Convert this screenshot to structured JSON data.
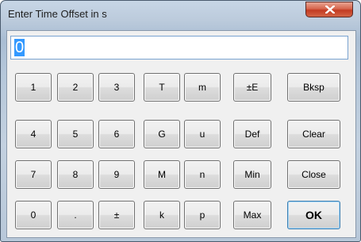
{
  "window": {
    "title": "Enter Time Offset in s"
  },
  "entry": {
    "value": "0"
  },
  "keys": {
    "1": "1",
    "2": "2",
    "3": "3",
    "4": "4",
    "5": "5",
    "6": "6",
    "7": "7",
    "8": "8",
    "9": "9",
    "0": "0",
    "dot": ".",
    "plusminus": "±",
    "T": "T",
    "G": "G",
    "M": "M",
    "k": "k",
    "m": "m",
    "u": "u",
    "n": "n",
    "p": "p",
    "exp": "±E",
    "def": "Def",
    "min": "Min",
    "max": "Max",
    "bksp": "Bksp",
    "clear": "Clear",
    "close": "Close",
    "ok": "OK"
  },
  "icons": {
    "close": "close-icon"
  }
}
